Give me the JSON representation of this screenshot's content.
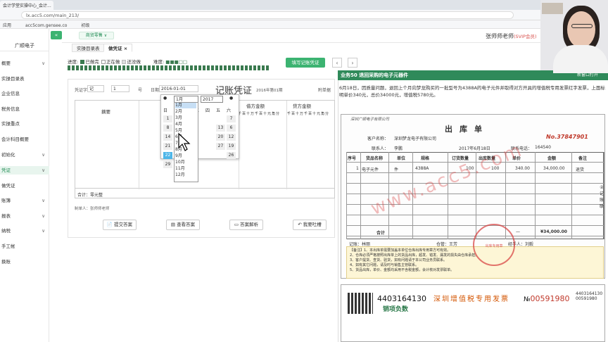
{
  "browser": {
    "tab_title": "会计学堂实操中心_会计...",
    "url": "lx.acc5.com/main_213/",
    "bookmarks": [
      "应用",
      "acc5com.gensee.co",
      "初级"
    ]
  },
  "sidebar": {
    "brand": "广顺电子",
    "items": [
      {
        "label": "概要",
        "chevron": true,
        "active": false
      },
      {
        "label": "实操目录表",
        "chevron": false,
        "active": false
      },
      {
        "label": "企业信息",
        "chevron": false,
        "active": false
      },
      {
        "label": "税务信息",
        "chevron": false,
        "active": false
      },
      {
        "label": "实操重点",
        "chevron": false,
        "active": false
      },
      {
        "label": "会计科目概要",
        "chevron": false,
        "active": false
      },
      {
        "label": "初始化",
        "chevron": true,
        "active": false
      },
      {
        "label": "凭证",
        "chevron": true,
        "active": true
      },
      {
        "label": "做凭证",
        "chevron": false,
        "active": false
      },
      {
        "label": "账簿",
        "chevron": true,
        "active": false
      },
      {
        "label": "报表",
        "chevron": true,
        "active": false
      },
      {
        "label": "纳税",
        "chevron": true,
        "active": false
      },
      {
        "label": "手工帐",
        "chevron": false,
        "active": false
      },
      {
        "label": "换账",
        "chevron": false,
        "active": false
      }
    ]
  },
  "header": {
    "store_button": "商贸零售 ∨",
    "teacher": "张师师老师",
    "teacher_badge": "(SVIP会员)",
    "collapse_icon": "«"
  },
  "tabs": [
    "实操目录表",
    "做凭证 ×"
  ],
  "progress": {
    "label": "进度:",
    "legend": [
      {
        "text": "已做完",
        "color": "#3a7a4f"
      },
      {
        "text": "正在做",
        "color": "#ffffff"
      },
      {
        "text": "还没做",
        "color": "#dddddd"
      }
    ],
    "difficulty_label": "难度:",
    "difficulty_stars": "■■■□□",
    "fill_button": "填写记账凭证",
    "prev": "‹",
    "next": "›"
  },
  "voucher": {
    "title": "记账凭证",
    "period": "2016年第01期",
    "word_label": "凭证字",
    "word_value": "记",
    "number_value": "1",
    "number_suffix": "号",
    "date_label": "日期",
    "date_value": "2016-01-01",
    "attachments_label": "附单据",
    "col_summary": "摘要",
    "col_debit": "借方金额",
    "col_credit": "贷方金额",
    "digit_units": [
      "千",
      "百",
      "十",
      "万",
      "千",
      "百",
      "十",
      "元",
      "角",
      "分"
    ],
    "total_label": "合计：零元整",
    "preparer": "制单人：张师师老师",
    "buttons": [
      "提交答案",
      "查看答案",
      "答案解析",
      "我要吐槽"
    ]
  },
  "calendar": {
    "month_select": "1月",
    "year_select": "2017",
    "weekdays": [
      "日",
      "一",
      "二",
      "三",
      "四",
      "五",
      "六"
    ],
    "months": [
      "1月",
      "2月",
      "3月",
      "4月",
      "5月",
      "6月",
      "7月",
      "8月",
      "9月",
      "10月",
      "11月",
      "12月"
    ],
    "visible_days": [
      "1",
      "8",
      "14",
      "21",
      "22",
      "29",
      "7",
      "13",
      "20",
      "27",
      "6",
      "12",
      "19",
      "26"
    ]
  },
  "business": {
    "header": "业务50 退回采购的电子元器件",
    "header_right": "新窗口打开",
    "description": "6月18日，因质量问题，退回上个月向梦龙购买的一批型号为4388A的电子元件并取得对方开具的增值税专用发票红字发票，上面标明单价340元，总价34000元，增值税5780元。",
    "slip": {
      "company": "深圳广顺电子有限公司",
      "title": "出库单",
      "number": "No.37847901",
      "customer_label": "客户名称：",
      "customer": "深圳梦龙电子有限公司",
      "date": "2017年6月18日",
      "contact_label": "联系人：",
      "contact": "李鹏",
      "phone_label": "联系电话：",
      "phone": "164540",
      "columns": [
        "序号",
        "货品名称",
        "单位",
        "规格",
        "订货数量",
        "出库数量",
        "单价",
        "金额",
        "备注"
      ],
      "rows": [
        [
          "1",
          "电子元件",
          "件",
          "4388A",
          "100",
          "100",
          "340.00",
          "34,000.00",
          "退货"
        ]
      ],
      "total_label": "合计",
      "total_amount": "¥34,000.00",
      "total_dash": "—",
      "bookkeeper": "记账：林丽",
      "warehouse": "仓管：王芳",
      "handler": "经手人：刘毅",
      "notes": [
        "【备注】1、本出库单需要加盖本单位仓库出库专用章方可有效。",
        "2、仓库必须严格按照出库单上的货品出库，超发、错发、漏发的损失由仓库承担。",
        "3、客户提货、查货、验货，如有问题请于本公司业务员联系。",
        "4、如有其它问题，请及时与销售主管联系。",
        "5、货品出库，单价、金额均采用不含税金额，会计核对发票联单。"
      ],
      "side_tab": "②记账联"
    },
    "invoice": {
      "code": "4403164130",
      "title": "深圳增值税专用发票",
      "no_prefix": "№",
      "no": "00591980",
      "code_small": "4403164130",
      "no_small": "00591980",
      "subtitle": "销项负数"
    },
    "watermark": "www.acc5.com"
  }
}
